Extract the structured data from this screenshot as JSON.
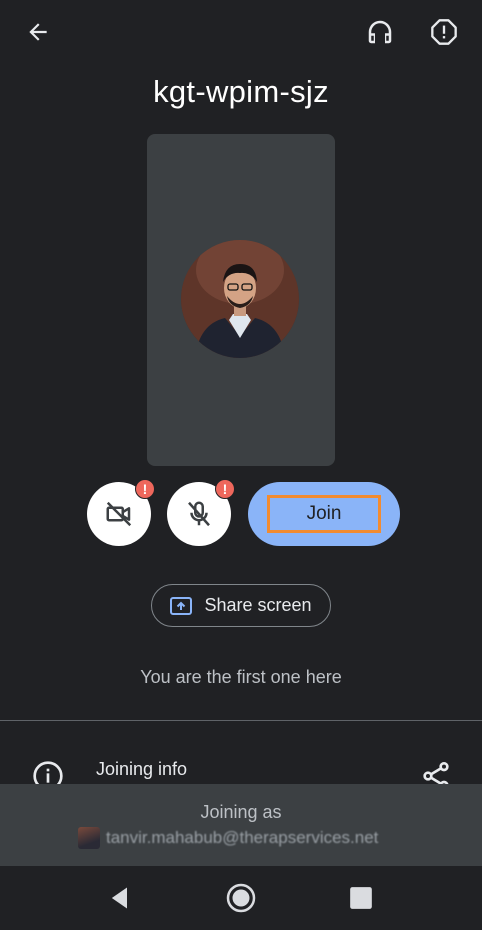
{
  "header": {
    "back_icon": "arrow-back-icon",
    "headset_icon": "headset-icon",
    "report_icon": "report-problem-icon"
  },
  "meeting": {
    "code": "kgt-wpim-sjz",
    "first_one_text": "You are the first one here"
  },
  "controls": {
    "camera_icon": "videocam-off-icon",
    "mic_icon": "mic-off-icon",
    "alert_glyph": "!",
    "join_label": "Join",
    "share_label": "Share screen"
  },
  "joining_info": {
    "label": "Joining info"
  },
  "joining_as": {
    "label": "Joining as",
    "email": "tanvir.mahabub@therapservices.net"
  },
  "colors": {
    "background": "#202124",
    "tile": "#3c4043",
    "join_button": "#8ab4f8",
    "alert": "#ee675c",
    "highlight": "#f28b30"
  }
}
